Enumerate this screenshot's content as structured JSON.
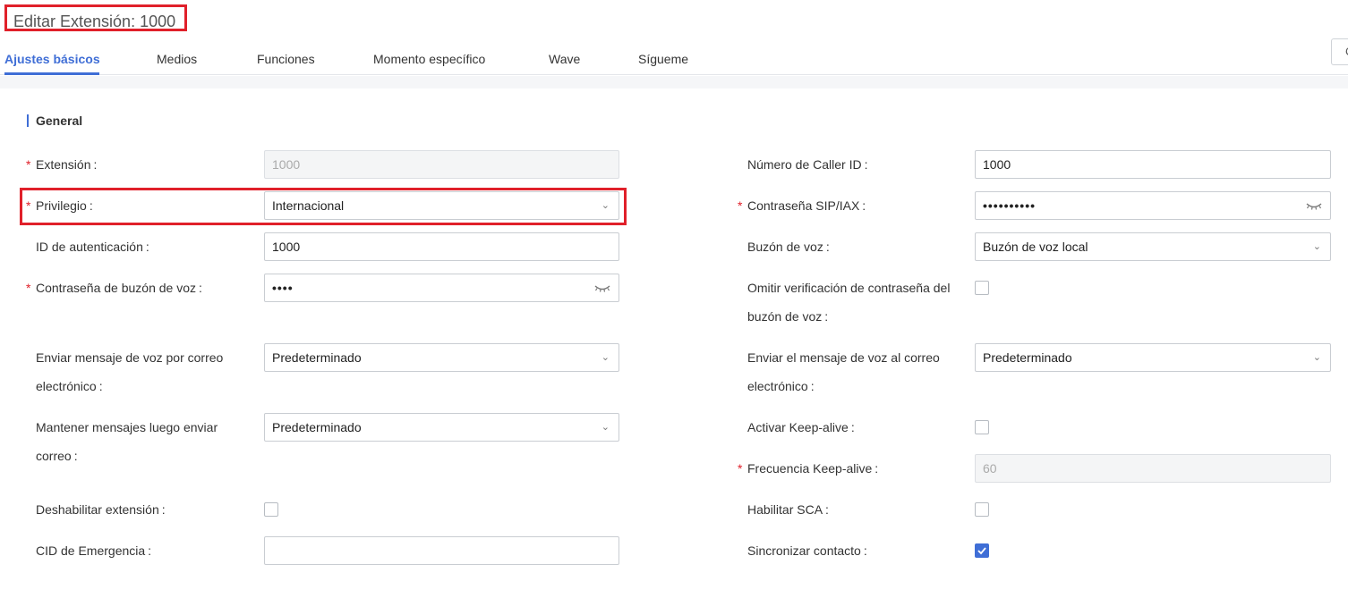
{
  "page": {
    "title": "Editar Extensión: 1000",
    "top_right_button": "C"
  },
  "tabs": [
    "Ajustes básicos",
    "Medios",
    "Funciones",
    "Momento específico",
    "Wave",
    "Sígueme"
  ],
  "section": {
    "title": "General"
  },
  "form": {
    "colon": ":",
    "left": {
      "extension": {
        "label": "Extensión",
        "value": "1000"
      },
      "privilege": {
        "label": "Privilegio",
        "value": "Internacional"
      },
      "auth_id": {
        "label": "ID de autenticación",
        "value": "1000"
      },
      "voicemail_password": {
        "label": "Contraseña de buzón de voz",
        "value": "••••"
      },
      "send_voicemail_email": {
        "label_line1": "Enviar mensaje de voz por correo",
        "label_line2": "electrónico",
        "value": "Predeterminado"
      },
      "keep_messages": {
        "label_line1": "Mantener mensajes luego enviar",
        "label_line2": "correo",
        "value": "Predeterminado"
      },
      "disable_extension": {
        "label": "Deshabilitar extensión",
        "checked": false
      },
      "emergency_cid": {
        "label": "CID de Emergencia",
        "value": ""
      }
    },
    "right": {
      "caller_id": {
        "label": "Número de Caller ID",
        "value": "1000"
      },
      "sip_password": {
        "label": "Contraseña SIP/IAX",
        "value": "••••••••••"
      },
      "voicemail": {
        "label": "Buzón de voz",
        "value": "Buzón de voz local"
      },
      "skip_vm_password": {
        "label_line1": "Omitir verificación de contraseña del",
        "label_line2": "buzón de voz",
        "checked": false
      },
      "send_vm_email": {
        "label_line1": "Enviar el mensaje de voz al correo",
        "label_line2": "electrónico",
        "value": "Predeterminado"
      },
      "keep_alive": {
        "label": "Activar Keep-alive",
        "checked": false
      },
      "keep_alive_freq": {
        "label": "Frecuencia Keep-alive",
        "value": "60"
      },
      "enable_sca": {
        "label": "Habilitar SCA",
        "checked": false
      },
      "sync_contact": {
        "label": "Sincronizar contacto",
        "checked": true
      }
    }
  },
  "colors": {
    "accent": "#3f6ed6",
    "required": "#e0202a",
    "highlight_box": "#e0202a"
  }
}
